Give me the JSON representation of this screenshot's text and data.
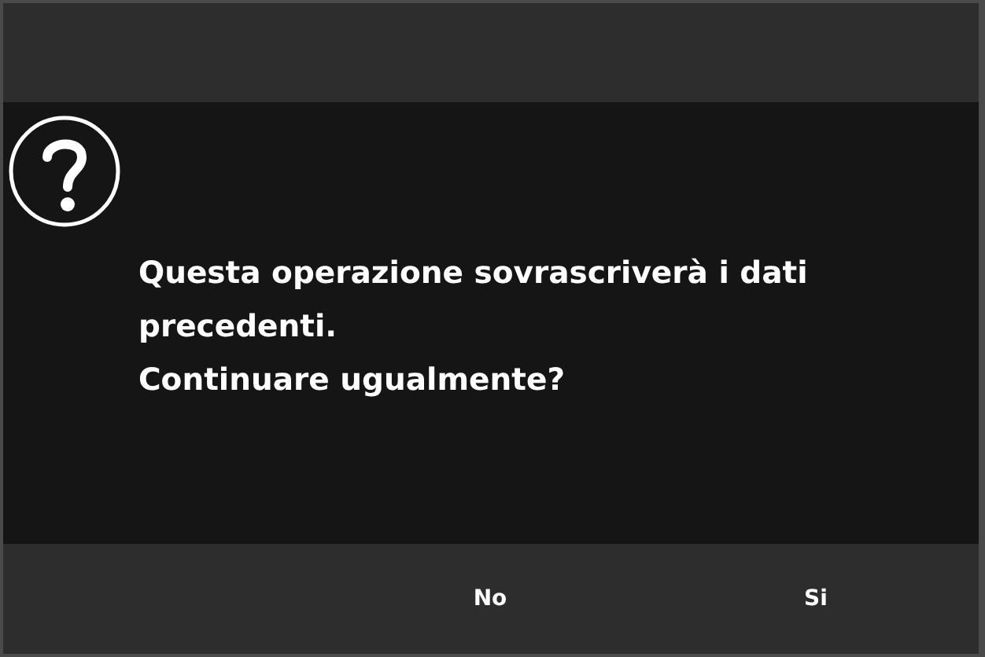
{
  "message": [
    "Questa operazione sovrascriverà i dati precedenti.",
    "Continuare ugualmente?"
  ],
  "buttons": [
    "No",
    "Si"
  ]
}
